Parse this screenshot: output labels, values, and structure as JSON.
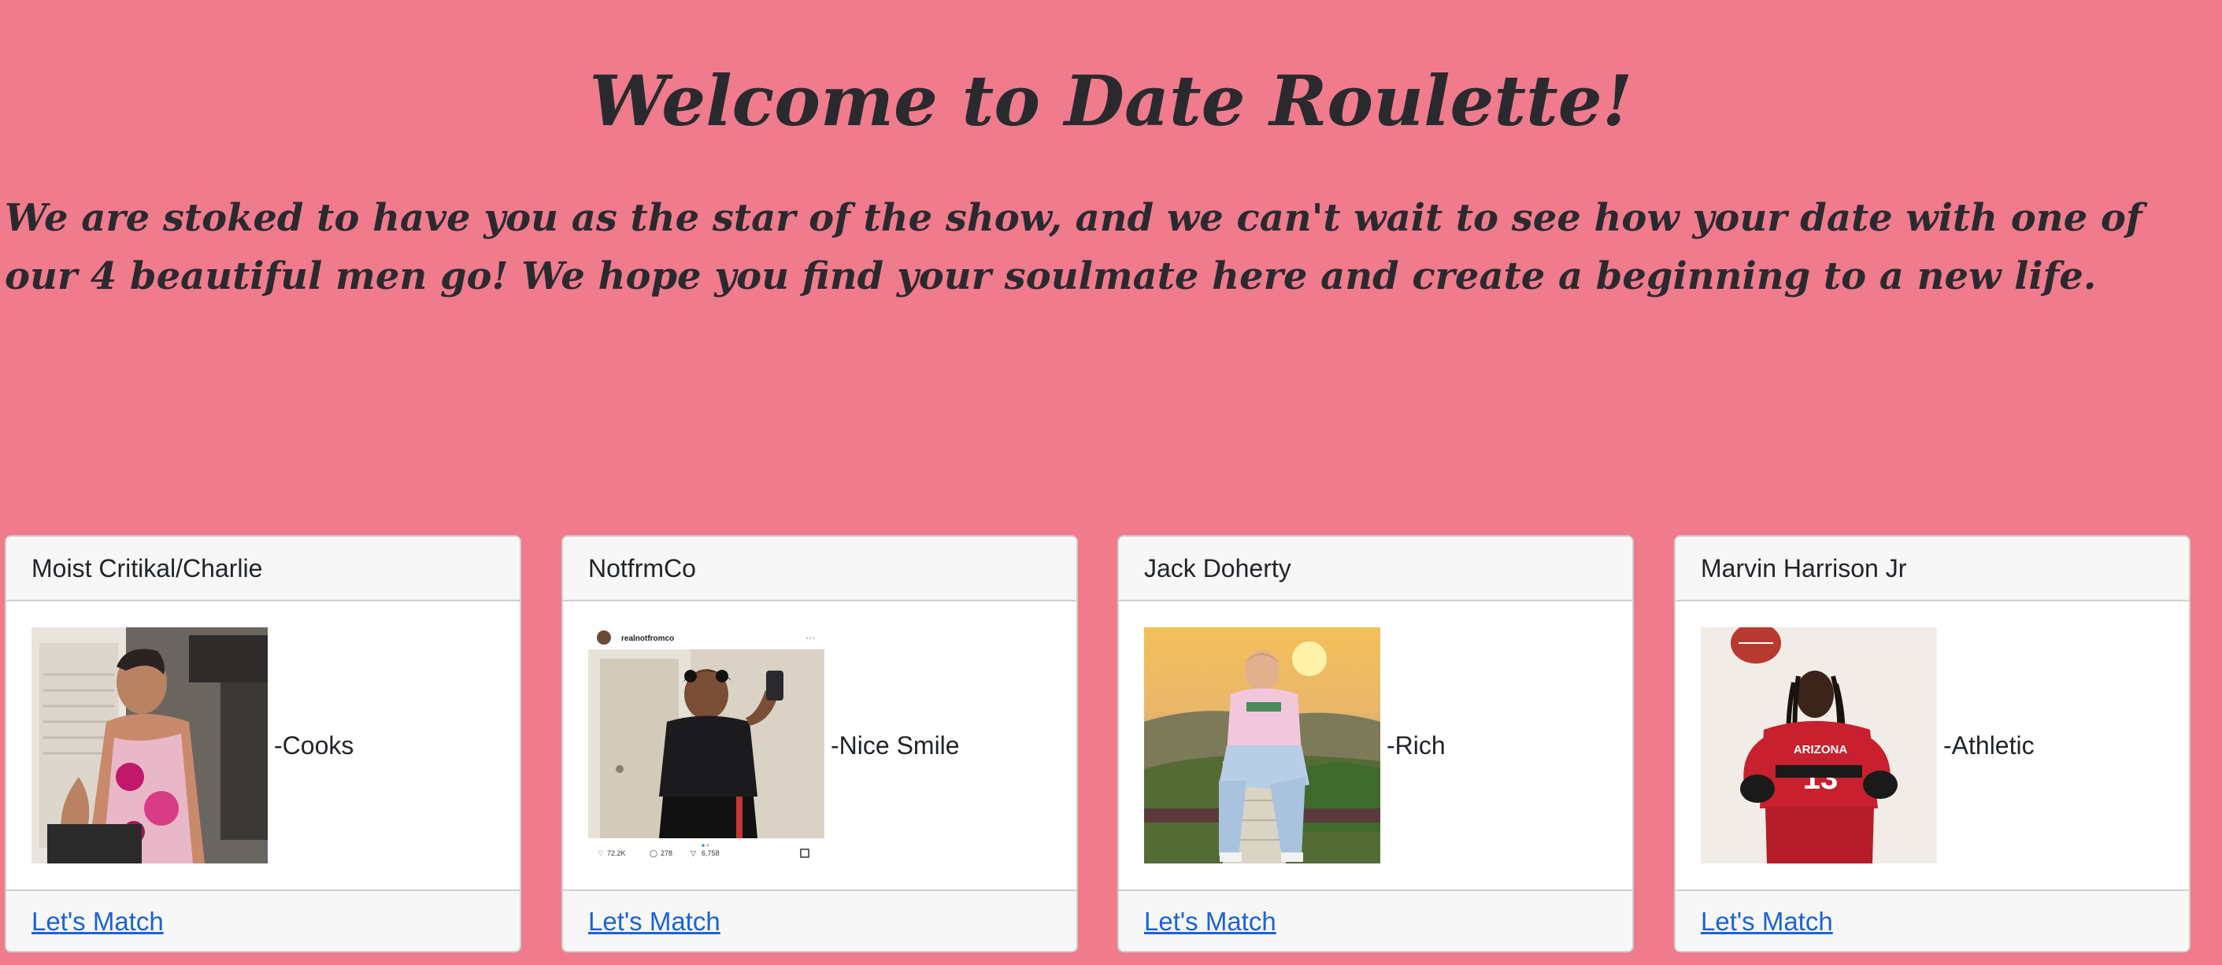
{
  "header": {
    "title": "Welcome to Date Roulette!",
    "intro": "We are stoked to have you as the star of the show, and we can't wait to see how your date with one of our 4 beautiful men go! We hope you find your soulmate here and create a beginning to a new life."
  },
  "cards": [
    {
      "name": "Moist Critikal/Charlie",
      "trait": "-Cooks",
      "link": "Let's Match"
    },
    {
      "name": "NotfrmCo",
      "trait": "-Nice Smile",
      "link": "Let's Match"
    },
    {
      "name": "Jack Doherty",
      "trait": "-Rich",
      "link": "Let's Match"
    },
    {
      "name": "Marvin Harrison Jr",
      "trait": "-Athletic",
      "link": "Let's Match"
    }
  ],
  "photo2": {
    "username": "realnotfromco",
    "likes": "72.2K",
    "comments": "278",
    "shares": "6,758"
  },
  "photo4": {
    "jersey_text": "ARIZONA"
  },
  "colors": {
    "background": "#ef7b8d",
    "link": "#1a63d6"
  }
}
